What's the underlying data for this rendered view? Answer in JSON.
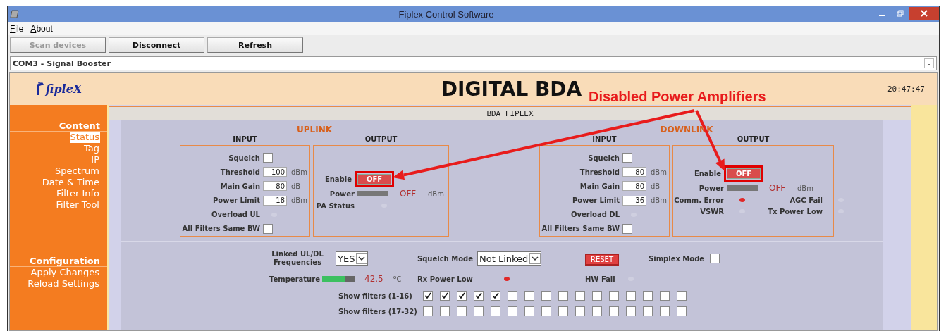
{
  "window": {
    "title": "Fiplex Control Software"
  },
  "menu": [
    {
      "label": "File"
    },
    {
      "label": "About"
    }
  ],
  "toolbar": [
    {
      "label": "Scan devices",
      "disabled": true
    },
    {
      "label": "Disconnect",
      "disabled": false
    },
    {
      "label": "Refresh",
      "disabled": false
    }
  ],
  "device_select": {
    "value": "COM3 - Signal Booster"
  },
  "header": {
    "logo": "fipleX",
    "title": "DIGITAL BDA",
    "time": "20:47:47"
  },
  "sidebar": [
    {
      "title": "Content",
      "items": [
        {
          "label": "Status",
          "selected": true
        },
        {
          "label": "Tag",
          "selected": false
        },
        {
          "label": "IP",
          "selected": false
        },
        {
          "label": "Spectrum",
          "selected": false
        },
        {
          "label": "Date & Time",
          "selected": false
        },
        {
          "label": "Filter Info",
          "selected": false
        },
        {
          "label": "Filter Tool",
          "selected": false
        }
      ]
    },
    {
      "title": "Configuration",
      "items": [
        {
          "label": "Apply Changes",
          "selected": false
        },
        {
          "label": "Reload Settings",
          "selected": false
        }
      ]
    }
  ],
  "panel": {
    "title": "BDA FIPLEX",
    "links": [
      {
        "title": "UPLINK",
        "input": {
          "heading": "INPUT",
          "rows": [
            {
              "kind": "checkbox",
              "label": "Squelch",
              "checked": false
            },
            {
              "kind": "field",
              "label": "Threshold",
              "value": "-100",
              "unit": "dBm"
            },
            {
              "kind": "field",
              "label": "Main Gain",
              "value": "80",
              "unit": "dB"
            },
            {
              "kind": "field",
              "label": "Power Limit",
              "value": "18",
              "unit": "dBm"
            },
            {
              "kind": "led",
              "label": "Overload UL",
              "on": false
            },
            {
              "kind": "checkbox",
              "label": "All Filters Same BW",
              "checked": false
            }
          ]
        },
        "output": {
          "heading": "OUTPUT",
          "enable": {
            "label": "Enable",
            "button": "OFF",
            "highlighted": true
          },
          "power": {
            "label": "Power",
            "reading": "OFF",
            "unit": "dBm"
          },
          "leds": [
            {
              "label": "PA Status",
              "on": false
            }
          ]
        }
      },
      {
        "title": "DOWNLINK",
        "input": {
          "heading": "INPUT",
          "rows": [
            {
              "kind": "checkbox",
              "label": "Squelch",
              "checked": false
            },
            {
              "kind": "field",
              "label": "Threshold",
              "value": "-80",
              "unit": "dBm"
            },
            {
              "kind": "field",
              "label": "Main Gain",
              "value": "80",
              "unit": "dB"
            },
            {
              "kind": "field",
              "label": "Power Limit",
              "value": "36",
              "unit": "dBm"
            },
            {
              "kind": "led",
              "label": "Overload DL",
              "on": false
            },
            {
              "kind": "checkbox",
              "label": "All Filters Same BW",
              "checked": false
            }
          ]
        },
        "output": {
          "heading": "OUTPUT",
          "enable": {
            "label": "Enable",
            "button": "OFF",
            "highlighted": true
          },
          "power": {
            "label": "Power",
            "reading": "OFF",
            "unit": "dBm"
          },
          "leds": [
            {
              "label": "Comm. Error",
              "on": true
            },
            {
              "label": "AGC Fail",
              "on": false
            },
            {
              "label": "VSWR",
              "on": false
            },
            {
              "label": "Tx Power Low",
              "on": false
            }
          ]
        }
      }
    ],
    "linked": {
      "label": "Linked UL/DL Frequencies",
      "value": "YES"
    },
    "squelch_mode": {
      "label": "Squelch Mode",
      "value": "Not Linked"
    },
    "reset": "RESET",
    "simplex": {
      "label": "Simplex Mode",
      "checked": false
    },
    "temperature": {
      "label": "Temperature",
      "level": 0.72,
      "reading": "42.5",
      "unit": "ºC"
    },
    "rx_power_low": {
      "label": "Rx Power Low",
      "on": true
    },
    "hw_fail": {
      "label": "HW Fail",
      "on": false
    },
    "filters": [
      {
        "label": "Show filters (1-16)",
        "checks": [
          true,
          true,
          true,
          true,
          true,
          false,
          false,
          false,
          false,
          false,
          false,
          false,
          false,
          false,
          false,
          false
        ]
      },
      {
        "label": "Show filters (17-32)",
        "checks": [
          false,
          false,
          false,
          false,
          false,
          false,
          false,
          false,
          false,
          false,
          false,
          false,
          false,
          false,
          false,
          false
        ]
      }
    ]
  },
  "annotation": {
    "text": "Disabled Power Amplifiers"
  }
}
